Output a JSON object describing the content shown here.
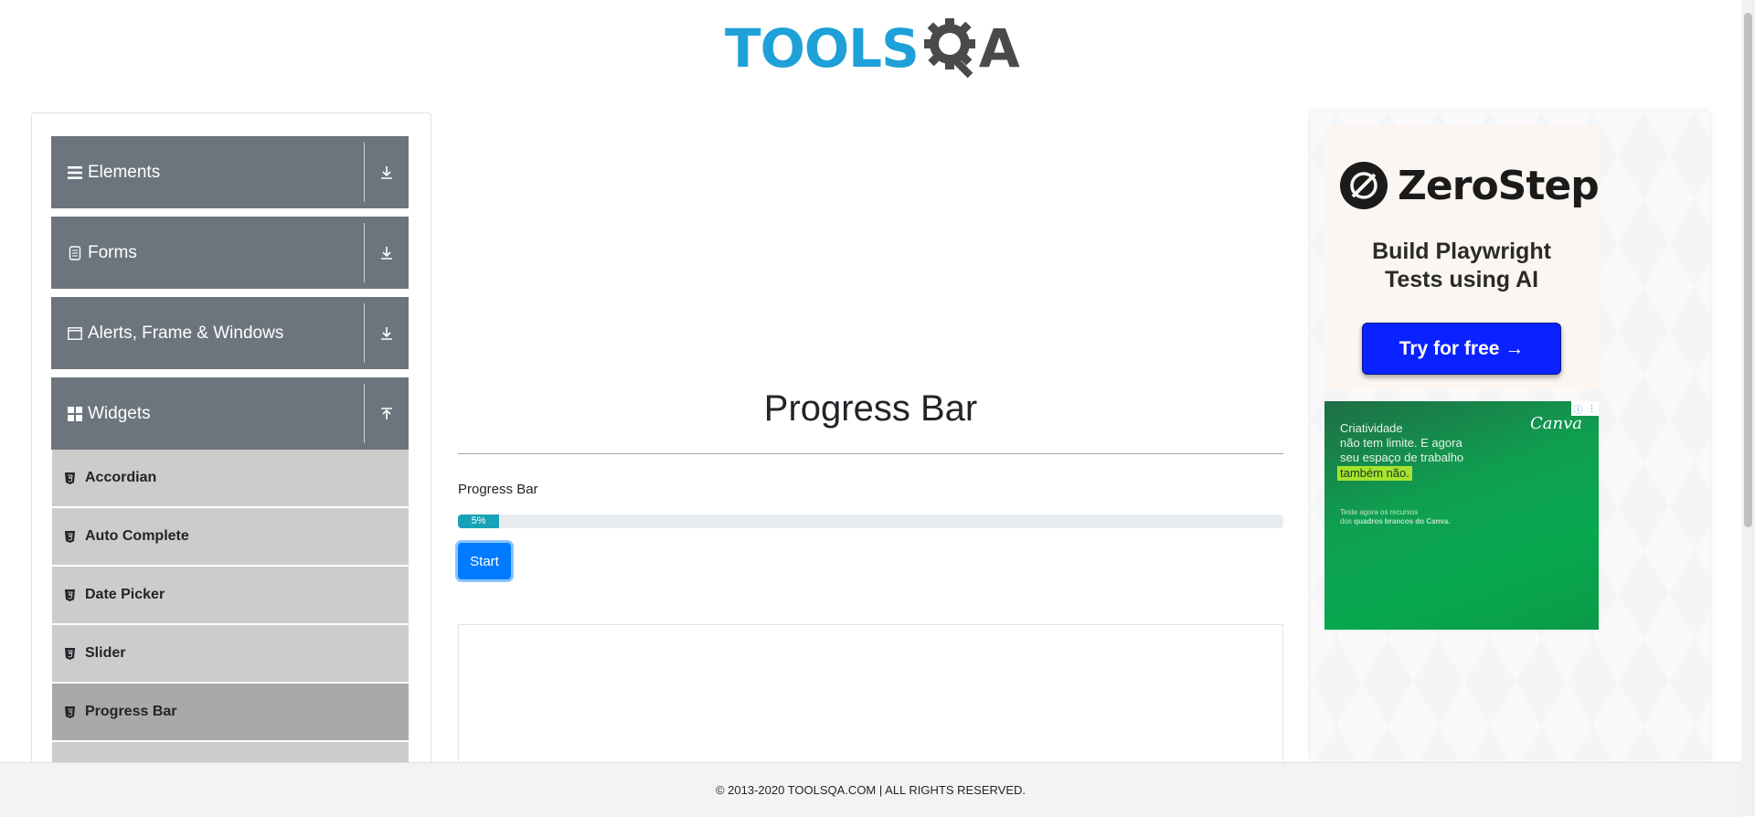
{
  "header": {
    "logo_text_main": "TOOLS",
    "logo_text_suffix": "A"
  },
  "sidebar": {
    "groups": [
      {
        "label": "Elements",
        "icon": "hamburger-icon",
        "expanded": false
      },
      {
        "label": "Forms",
        "icon": "document-icon",
        "expanded": false
      },
      {
        "label": "Alerts, Frame & Windows",
        "icon": "window-icon",
        "expanded": false
      },
      {
        "label": "Widgets",
        "icon": "widgets-icon",
        "expanded": true
      }
    ],
    "widget_items": [
      {
        "label": "Accordian",
        "active": false
      },
      {
        "label": "Auto Complete",
        "active": false
      },
      {
        "label": "Date Picker",
        "active": false
      },
      {
        "label": "Slider",
        "active": false
      },
      {
        "label": "Progress Bar",
        "active": true
      }
    ]
  },
  "main": {
    "title": "Progress Bar",
    "progress_label": "Progress Bar",
    "progress_text": "5%",
    "progress_value": 5,
    "start_label": "Start"
  },
  "ads": {
    "ad1": {
      "brand": "ZeroStep",
      "headline_line1": "Build Playwright",
      "headline_line2": "Tests using AI",
      "cta": "Try for free →"
    },
    "ad2": {
      "brand": "Canva",
      "line1": "Criatividade",
      "line2": "não tem limite. E agora",
      "line3": "seu espaço de trabalho",
      "highlight": "também não.",
      "small1": "Teste agora os recursos",
      "small2_prefix": "dos ",
      "small2_bold": "quadros brancos do Canva."
    }
  },
  "footer": {
    "text": "© 2013-2020 TOOLSQA.COM | ALL RIGHTS RESERVED."
  },
  "colors": {
    "logo_blue": "#1ea1d9",
    "sidebar_group": "#6c757d",
    "sidebar_item": "#cccccc",
    "sidebar_item_active": "#a9a9a9",
    "progress_fill": "#17a2b8",
    "primary_button": "#007bff"
  }
}
